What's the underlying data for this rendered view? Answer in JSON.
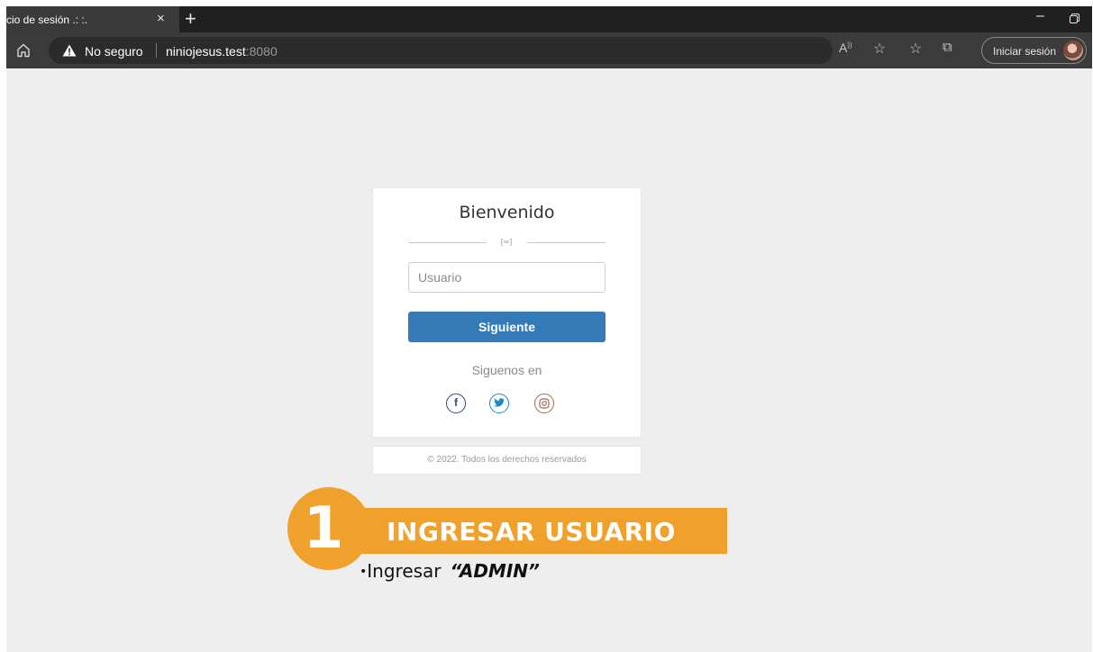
{
  "browser": {
    "tab_title": "cio de sesión .: :.",
    "tab_close": "×",
    "new_tab": "+",
    "minimize": "–",
    "security_label": "No seguro",
    "url_host": "niniojesus.test",
    "url_port": ":8080",
    "signin_label": "Iniciar sesión",
    "icons": [
      "home-icon",
      "warning-icon",
      "read-aloud-icon",
      "add-favorite-icon",
      "favorites-icon",
      "collections-icon",
      "avatar"
    ]
  },
  "login": {
    "title": "Bienvenido",
    "divider": "[∞]",
    "username_placeholder": "Usuario",
    "submit_label": "Siguiente",
    "follow_label": "Siguenos en",
    "social": [
      "facebook-icon",
      "twitter-icon",
      "instagram-icon"
    ],
    "footer": "© 2022. Todos los derechos reservados"
  },
  "annotation": {
    "step_number": "1",
    "title": "INGRESAR USUARIO",
    "bullet": "•",
    "note_prefix": "Ingresar",
    "note_value": "“ADMIN”",
    "accent_color": "#f0a12c"
  },
  "colors": {
    "primary_button": "#337ab7",
    "page_background": "#eeeeee"
  }
}
